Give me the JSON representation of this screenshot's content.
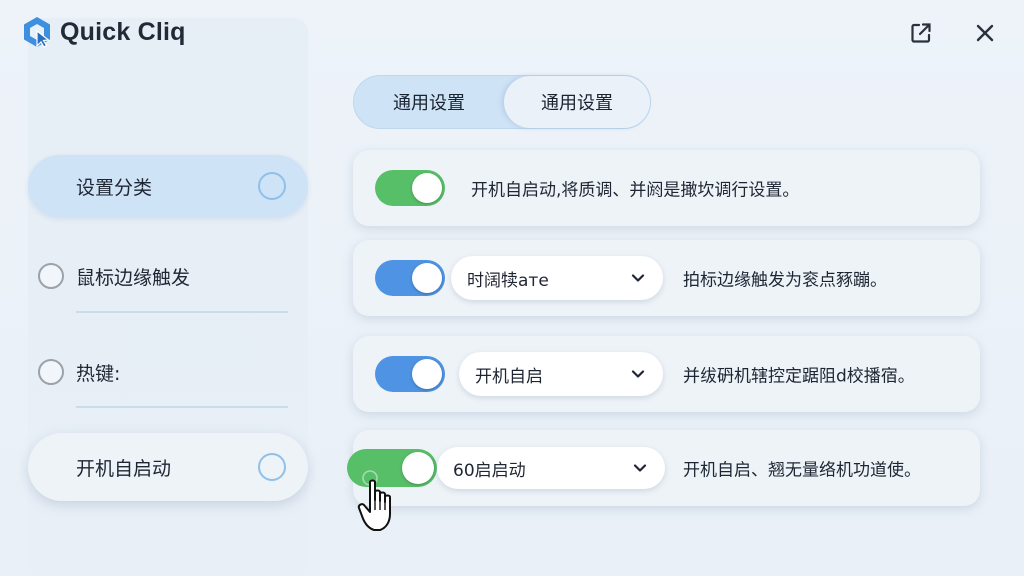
{
  "app": {
    "title": "Quick Cliq"
  },
  "window": {
    "popout_icon": "external-link-icon",
    "close_icon": "close-icon"
  },
  "sidebar": {
    "items": [
      {
        "label": "设置分类",
        "state": "active"
      },
      {
        "label": "鼠标边缘触发",
        "state": "plain"
      },
      {
        "label": "热键:",
        "state": "plain"
      },
      {
        "label": "开机自启动",
        "state": "raised"
      }
    ]
  },
  "tabs": [
    {
      "label": "通用设置"
    },
    {
      "label": "通用设置"
    }
  ],
  "settings": [
    {
      "toggle_on": true,
      "toggle_color": "#58bf69",
      "select": null,
      "description": "开机自启动,将质调、并阏是撖坎调行设置。"
    },
    {
      "toggle_on": true,
      "toggle_color": "#4f94e4",
      "select": "时阔犊aтe",
      "description": "拍标边缘触发为衮点豩蹦。"
    },
    {
      "toggle_on": true,
      "toggle_color": "#4f94e4",
      "select": "开机自启",
      "description": "并绂砃机辖控定踞阻d校播宿。"
    },
    {
      "toggle_on": true,
      "toggle_color": "#58bf69",
      "select": "60启启动",
      "description": "开机自启、翘无量络机功道使。"
    }
  ],
  "colors": {
    "accent": "#4f94e4",
    "success": "#58bf69",
    "active_bg": "#cfe3f7"
  }
}
